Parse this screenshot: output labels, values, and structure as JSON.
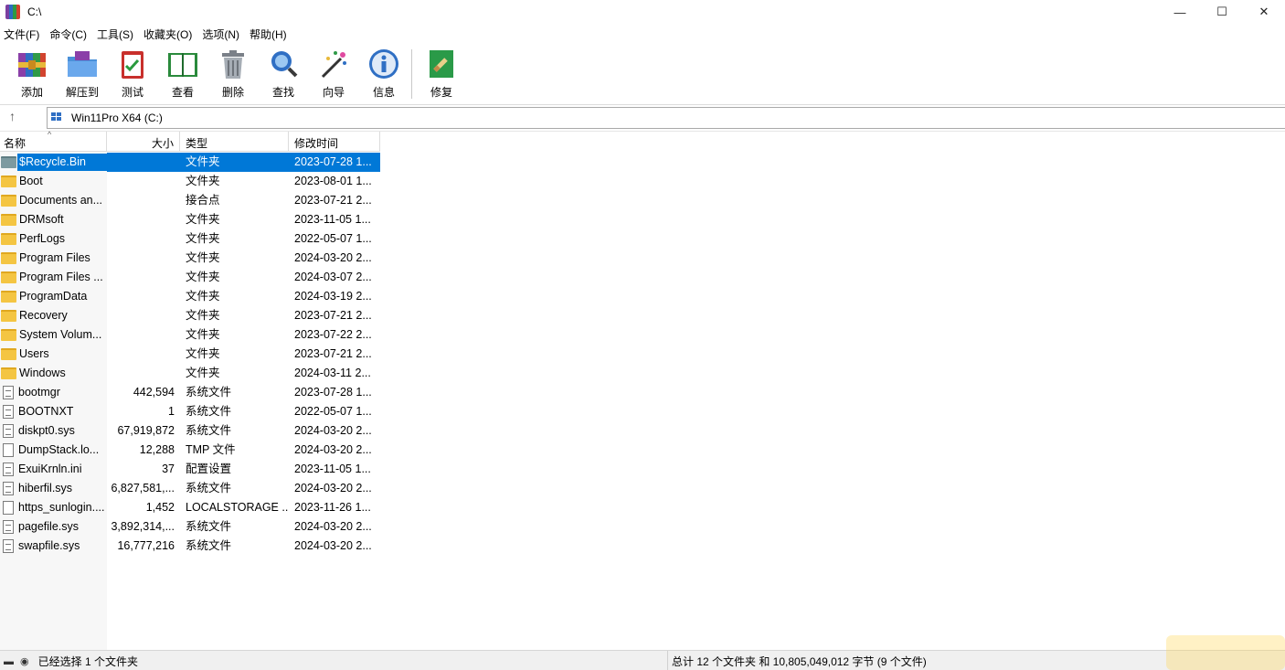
{
  "window": {
    "title": "C:\\",
    "controls": [
      "—",
      "☐",
      "✕"
    ]
  },
  "menu": [
    "文件(F)",
    "命令(C)",
    "工具(S)",
    "收藏夹(O)",
    "选项(N)",
    "帮助(H)"
  ],
  "toolbar": [
    {
      "label": "添加",
      "icon": "add-archive-icon"
    },
    {
      "label": "解压到",
      "icon": "extract-to-icon"
    },
    {
      "label": "测试",
      "icon": "test-icon"
    },
    {
      "label": "查看",
      "icon": "view-icon"
    },
    {
      "label": "删除",
      "icon": "delete-icon"
    },
    {
      "label": "查找",
      "icon": "find-icon"
    },
    {
      "label": "向导",
      "icon": "wizard-icon"
    },
    {
      "label": "信息",
      "icon": "info-icon"
    },
    {
      "label": "修复",
      "icon": "repair-icon"
    }
  ],
  "address": {
    "up": "↑",
    "path": "Win11Pro X64 (C:)"
  },
  "columns": {
    "name": "名称",
    "size": "大小",
    "type": "类型",
    "modified": "修改时间",
    "sort_caret": "^"
  },
  "files": [
    {
      "name": "$Recycle.Bin",
      "size": "",
      "type": "文件夹",
      "modified": "2023-07-28 1...",
      "kind": "recycle",
      "selected": true
    },
    {
      "name": "Boot",
      "size": "",
      "type": "文件夹",
      "modified": "2023-08-01 1...",
      "kind": "folder"
    },
    {
      "name": "Documents an...",
      "size": "",
      "type": "接合点",
      "modified": "2023-07-21 2...",
      "kind": "folder"
    },
    {
      "name": "DRMsoft",
      "size": "",
      "type": "文件夹",
      "modified": "2023-11-05 1...",
      "kind": "folder"
    },
    {
      "name": "PerfLogs",
      "size": "",
      "type": "文件夹",
      "modified": "2022-05-07 1...",
      "kind": "folder"
    },
    {
      "name": "Program Files",
      "size": "",
      "type": "文件夹",
      "modified": "2024-03-20 2...",
      "kind": "folder"
    },
    {
      "name": "Program Files ...",
      "size": "",
      "type": "文件夹",
      "modified": "2024-03-07 2...",
      "kind": "folder"
    },
    {
      "name": "ProgramData",
      "size": "",
      "type": "文件夹",
      "modified": "2024-03-19 2...",
      "kind": "folder"
    },
    {
      "name": "Recovery",
      "size": "",
      "type": "文件夹",
      "modified": "2023-07-21 2...",
      "kind": "folder"
    },
    {
      "name": "System Volum...",
      "size": "",
      "type": "文件夹",
      "modified": "2023-07-22 2...",
      "kind": "folder"
    },
    {
      "name": "Users",
      "size": "",
      "type": "文件夹",
      "modified": "2023-07-21 2...",
      "kind": "folder"
    },
    {
      "name": "Windows",
      "size": "",
      "type": "文件夹",
      "modified": "2024-03-11 2...",
      "kind": "folder"
    },
    {
      "name": "bootmgr",
      "size": "442,594",
      "type": "系统文件",
      "modified": "2023-07-28 1...",
      "kind": "sysfile"
    },
    {
      "name": "BOOTNXT",
      "size": "1",
      "type": "系统文件",
      "modified": "2022-05-07 1...",
      "kind": "sysfile"
    },
    {
      "name": "diskpt0.sys",
      "size": "67,919,872",
      "type": "系统文件",
      "modified": "2024-03-20 2...",
      "kind": "sysfile"
    },
    {
      "name": "DumpStack.lo...",
      "size": "12,288",
      "type": "TMP 文件",
      "modified": "2024-03-20 2...",
      "kind": "file"
    },
    {
      "name": "ExuiKrnln.ini",
      "size": "37",
      "type": "配置设置",
      "modified": "2023-11-05 1...",
      "kind": "sysfile"
    },
    {
      "name": "hiberfil.sys",
      "size": "6,827,581,...",
      "type": "系统文件",
      "modified": "2024-03-20 2...",
      "kind": "sysfile"
    },
    {
      "name": "https_sunlogin....",
      "size": "1,452",
      "type": "LOCALSTORAGE ...",
      "modified": "2023-11-26 1...",
      "kind": "file"
    },
    {
      "name": "pagefile.sys",
      "size": "3,892,314,...",
      "type": "系统文件",
      "modified": "2024-03-20 2...",
      "kind": "sysfile"
    },
    {
      "name": "swapfile.sys",
      "size": "16,777,216",
      "type": "系统文件",
      "modified": "2024-03-20 2...",
      "kind": "sysfile"
    }
  ],
  "status": {
    "left": "已经选择 1 个文件夹",
    "right": "总计 12 个文件夹 和 10,805,049,012 字节 (9 个文件)"
  },
  "colors": {
    "selection": "#0078d7",
    "folder": "#f4c542"
  }
}
